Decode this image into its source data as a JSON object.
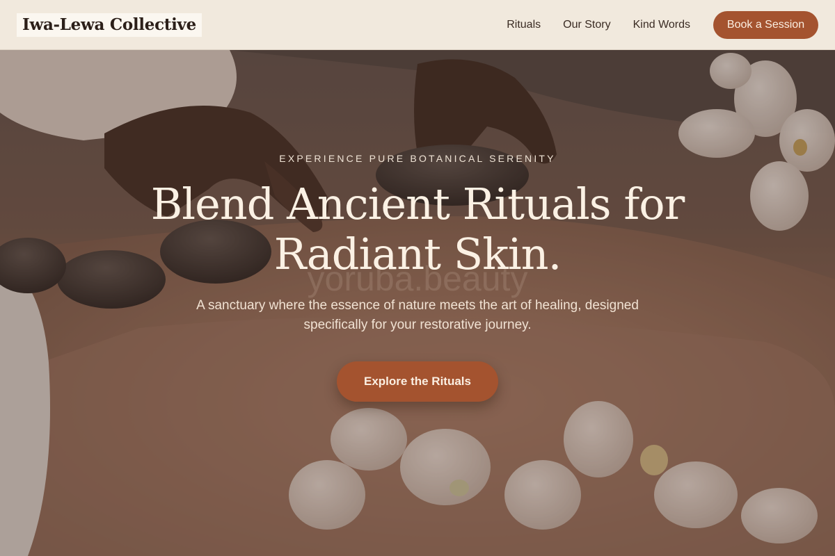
{
  "header": {
    "logo": "Iwa-Lewa Collective",
    "nav": [
      "Rituals",
      "Our Story",
      "Kind Words"
    ],
    "cta": "Book a Session"
  },
  "hero": {
    "eyebrow": "EXPERIENCE PURE BOTANICAL SERENITY",
    "headline_line1": "Blend Ancient Rituals for",
    "headline_line2": "Radiant Skin.",
    "watermark": "yoruba.beauty",
    "subtext": "A sanctuary where the essence of nature meets the art of healing, designed specifically for your restorative journey.",
    "cta": "Explore the Rituals"
  },
  "colors": {
    "accent": "#a4532f",
    "header_bg": "#f1e9dd",
    "hero_text": "#fbf1e4"
  }
}
